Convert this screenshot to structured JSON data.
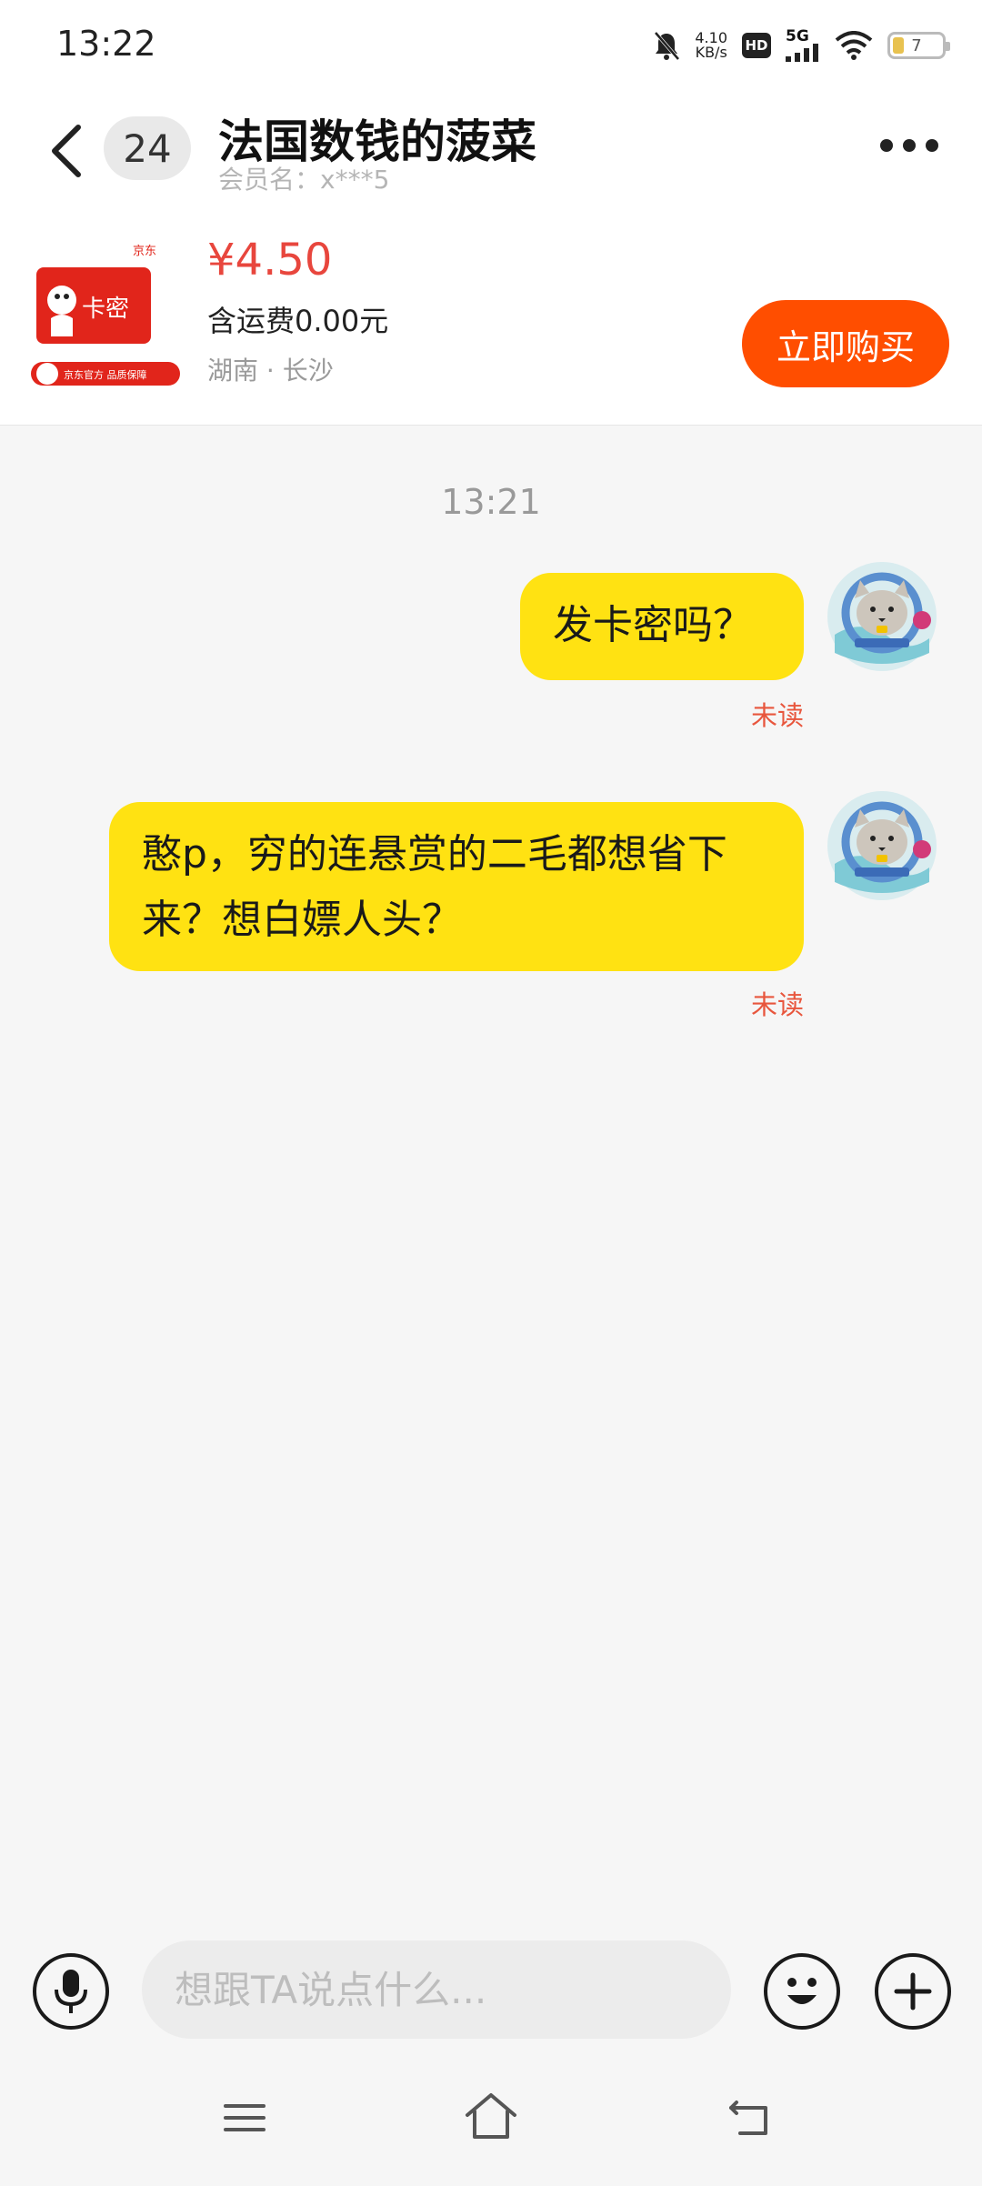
{
  "status_bar": {
    "time": "13:22",
    "net_speed_value": "4.10",
    "net_speed_unit": "KB/s",
    "hd_label": "HD",
    "network": "5G",
    "battery_level": "7"
  },
  "header": {
    "unread_count": "24",
    "title": "法国数钱的菠菜",
    "member_name": "会员名：x***5"
  },
  "product": {
    "image_brand": "京东",
    "image_card_text": "卡密",
    "image_banner_text": "京东官方 品质保障",
    "price": "¥4.50",
    "shipping": "含运费0.00元",
    "location": "湖南 · 长沙",
    "buy_label": "立即购买"
  },
  "chat": {
    "time": "13:21",
    "messages": [
      {
        "text": "发卡密吗？",
        "status": "未读"
      },
      {
        "text": "憨p，穷的连悬赏的二毛都想省下来？想白嫖人头？",
        "status": "未读"
      }
    ]
  },
  "input": {
    "placeholder": "想跟TA说点什么..."
  },
  "colors": {
    "accent": "#ff4e00",
    "price": "#e8463d",
    "bubble": "#ffe212",
    "unread": "#e8563d"
  },
  "icons": [
    "back-icon",
    "more-icon",
    "microphone-icon",
    "emoji-icon",
    "plus-icon",
    "menu-icon",
    "home-icon",
    "return-icon",
    "mute-bell-icon",
    "wifi-icon",
    "signal-icon"
  ]
}
